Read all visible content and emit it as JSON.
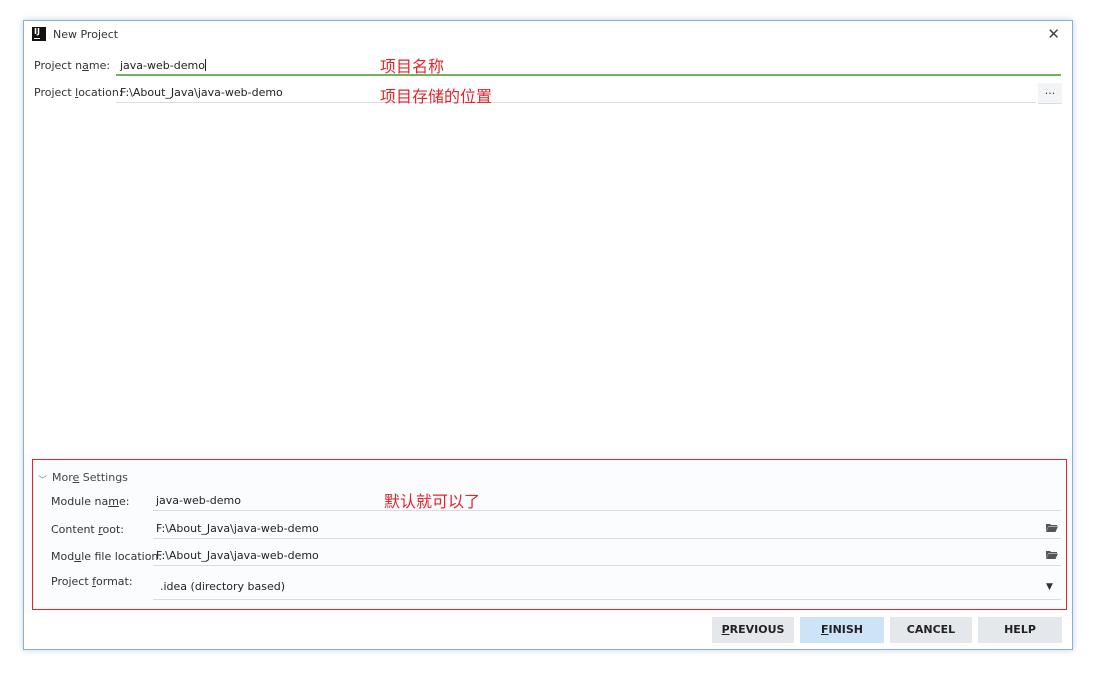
{
  "window": {
    "title": "New Project",
    "close_glyph": "✕",
    "app_icon": "intellij-icon"
  },
  "project": {
    "name_label_pre": "Project n",
    "name_label_mn": "a",
    "name_label_post": "me:",
    "name_value": "java-web-demo",
    "location_label_pre": "Project ",
    "location_label_mn": "l",
    "location_label_post": "ocation:",
    "location_value": "F:\\About_Java\\java-web-demo",
    "browse_label": "..."
  },
  "annotations": {
    "name_note": "项目名称",
    "location_note": "项目存储的位置",
    "more_note": "默认就可以了",
    "color": "#e0262a"
  },
  "more_settings": {
    "header_pre": "Mor",
    "header_mn": "e",
    "header_post": " Settings",
    "module_name_label_pre": "Module na",
    "module_name_label_mn": "m",
    "module_name_label_post": "e:",
    "module_name_value": "java-web-demo",
    "content_root_label_pre": "Content ",
    "content_root_label_mn": "r",
    "content_root_label_post": "oot:",
    "content_root_value": "F:\\About_Java\\java-web-demo",
    "module_file_label_pre": "Mod",
    "module_file_label_mn": "u",
    "module_file_label_post": "le file location:",
    "module_file_value": "F:\\About_Java\\java-web-demo",
    "format_label_pre": "Project ",
    "format_label_mn": "f",
    "format_label_post": "ormat:",
    "format_value": ".idea (directory based)",
    "dropdown_glyph": "▼",
    "folder_icon": "folder-open-icon"
  },
  "buttons": {
    "previous_mn": "P",
    "previous_rest": "REVIOUS",
    "finish_mn": "F",
    "finish_rest": "INISH",
    "cancel": "CANCEL",
    "help": "HELP"
  },
  "colors": {
    "focus_underline": "#6fb35a",
    "primary_button": "#cfe3f7",
    "window_border": "#8fb0d6"
  }
}
